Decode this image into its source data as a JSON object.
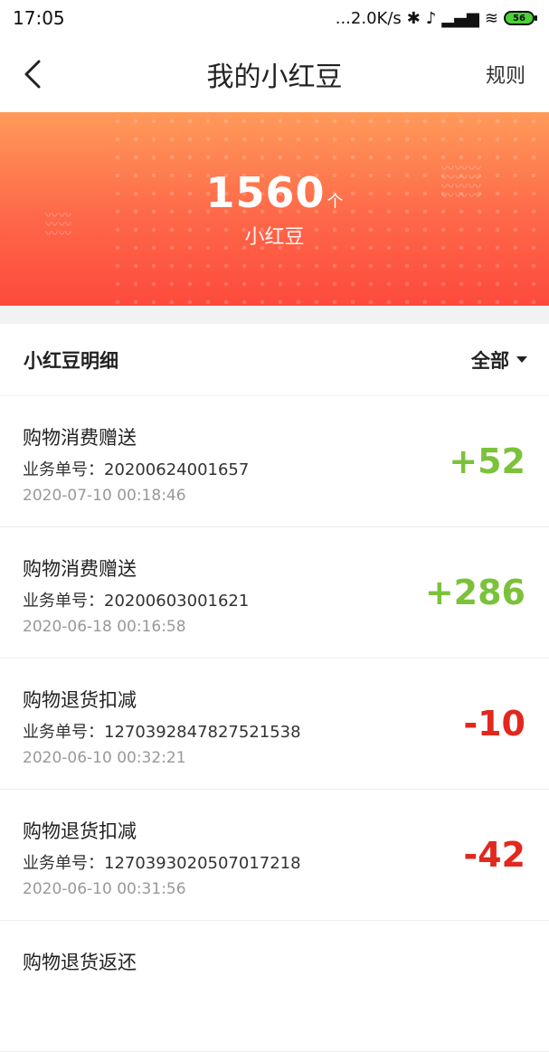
{
  "status_bar": {
    "time": "17:05",
    "network_speed": "...2.0K/s",
    "battery": "56",
    "icons": [
      "bluetooth-icon",
      "mute-icon",
      "signal-icon",
      "wifi-icon",
      "battery-icon"
    ]
  },
  "header": {
    "title": "我的小红豆",
    "rules_label": "规则",
    "back_icon": "chevron-left-icon"
  },
  "banner": {
    "points": "1560",
    "unit": "个",
    "label": "小红豆"
  },
  "detail": {
    "title": "小红豆明细",
    "filter_label": "全部"
  },
  "records": [
    {
      "title": "购物消费赠送",
      "order": "业务单号：20200624001657",
      "time": "2020-07-10 00:18:46",
      "amount": "+52",
      "type": "positive"
    },
    {
      "title": "购物消费赠送",
      "order": "业务单号：20200603001621",
      "time": "2020-06-18 00:16:58",
      "amount": "+286",
      "type": "positive"
    },
    {
      "title": "购物退货扣减",
      "order": "业务单号：1270392847827521538",
      "time": "2020-06-10 00:32:21",
      "amount": "-10",
      "type": "negative"
    },
    {
      "title": "购物退货扣减",
      "order": "业务单号：1270393020507017218",
      "time": "2020-06-10 00:31:56",
      "amount": "-42",
      "type": "negative"
    },
    {
      "title": "购物退货返还",
      "order": "",
      "time": "",
      "amount": "",
      "type": "positive"
    }
  ],
  "colors": {
    "positive": "#7bc23a",
    "negative": "#e2281e",
    "banner_top": "#ff9a5a",
    "banner_bottom": "#fd4a3c"
  }
}
